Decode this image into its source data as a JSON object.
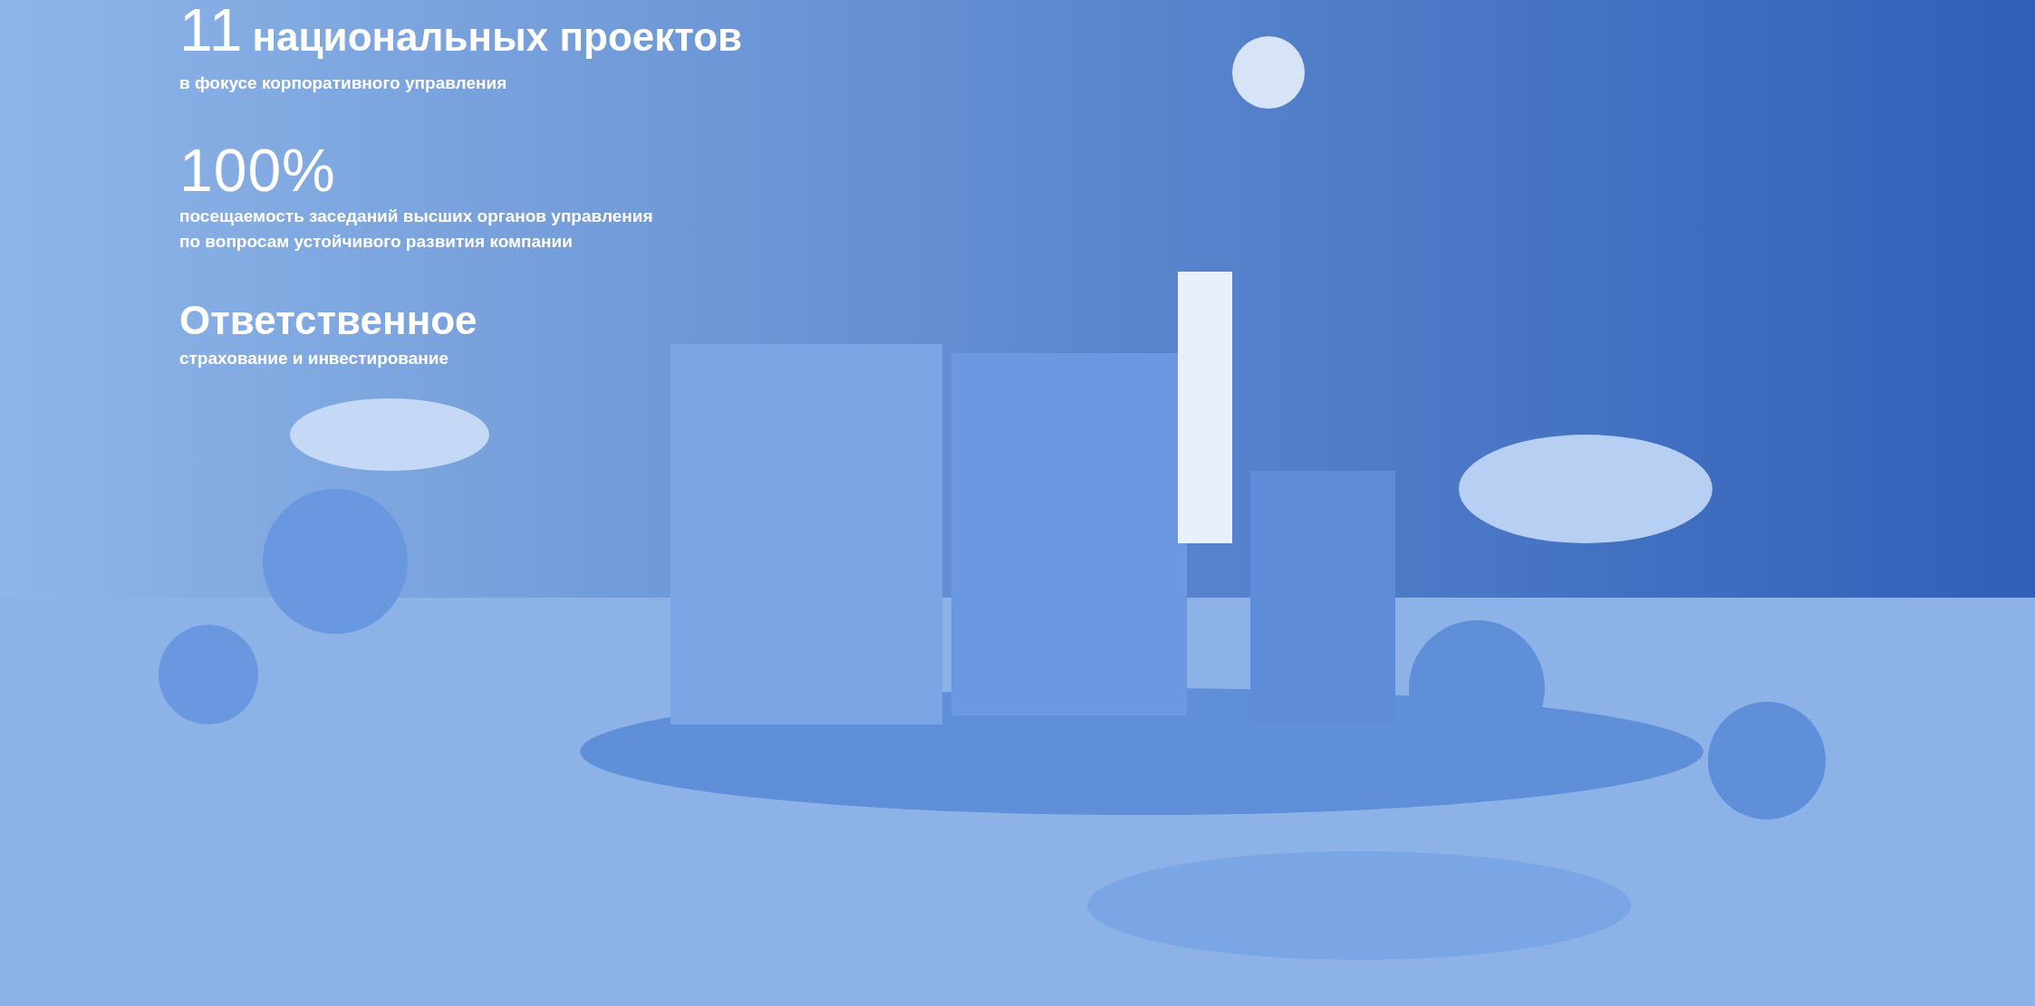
{
  "stats": [
    {
      "value": "11",
      "label": "национальных проектов",
      "caption": "в фокусе корпоративного управления"
    },
    {
      "value": "100%",
      "caption": "посещаемость заседаний высших органов управления\nпо вопросам устойчивого развития компании"
    },
    {
      "value": "Ответственное",
      "caption": "страхование и инвестирование"
    }
  ]
}
